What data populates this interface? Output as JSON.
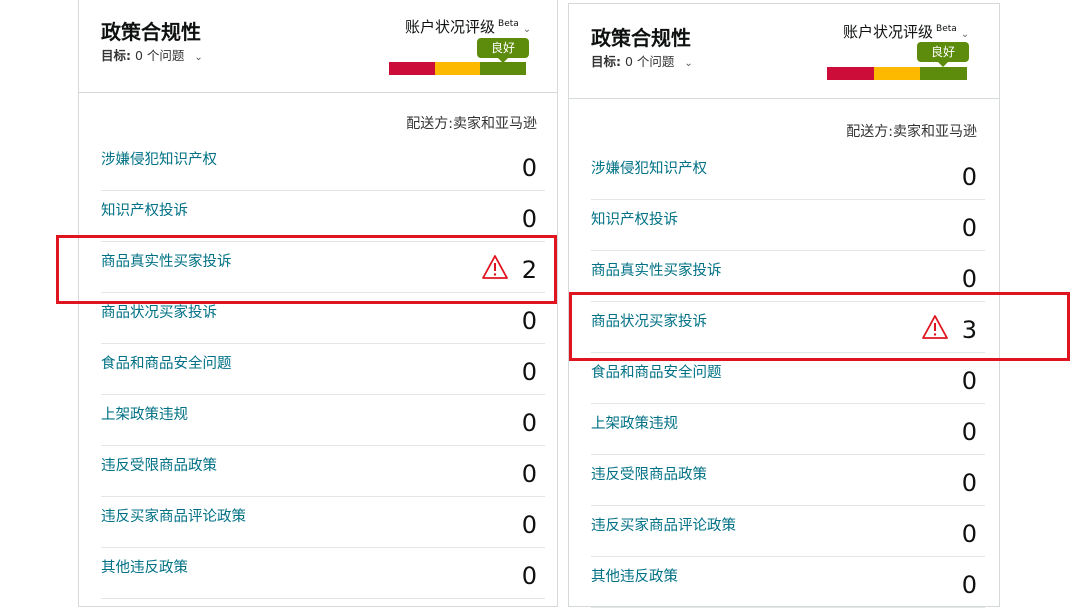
{
  "left": {
    "title": "政策合规性",
    "goal_label": "目标:",
    "goal_value": "0 个问题",
    "rating_label": "账户状况评级",
    "beta": "Beta",
    "badge": "良好",
    "ship_label": "配送方:卖家和亚马逊",
    "rows": [
      {
        "label": "涉嫌侵犯知识产权",
        "count": "0"
      },
      {
        "label": "知识产权投诉",
        "count": "0"
      },
      {
        "label": "商品真实性买家投诉",
        "count": "2",
        "warning": true
      },
      {
        "label": "商品状况买家投诉",
        "count": "0"
      },
      {
        "label": "食品和商品安全问题",
        "count": "0"
      },
      {
        "label": "上架政策违规",
        "count": "0"
      },
      {
        "label": "违反受限商品政策",
        "count": "0"
      },
      {
        "label": "违反买家商品评论政策",
        "count": "0"
      },
      {
        "label": "其他违反政策",
        "count": "0"
      }
    ]
  },
  "right": {
    "title": "政策合规性",
    "goal_label": "目标:",
    "goal_value": "0 个问题",
    "rating_label": "账户状况评级",
    "beta": "Beta",
    "badge": "良好",
    "ship_label": "配送方:卖家和亚马逊",
    "rows": [
      {
        "label": "涉嫌侵犯知识产权",
        "count": "0"
      },
      {
        "label": "知识产权投诉",
        "count": "0"
      },
      {
        "label": "商品真实性买家投诉",
        "count": "0"
      },
      {
        "label": "商品状况买家投诉",
        "count": "3",
        "warning": true
      },
      {
        "label": "食品和商品安全问题",
        "count": "0"
      },
      {
        "label": "上架政策违规",
        "count": "0"
      },
      {
        "label": "违反受限商品政策",
        "count": "0"
      },
      {
        "label": "违反买家商品评论政策",
        "count": "0"
      },
      {
        "label": "其他违反政策",
        "count": "0"
      }
    ]
  },
  "colors": {
    "link": "#007185",
    "rating_red": "#cc0c39",
    "rating_yellow": "#fcb900",
    "rating_green": "#5d8b0c",
    "highlight": "#e0141e"
  },
  "icons": {
    "warning": "warning-triangle-icon",
    "caret": "chevron-down-icon"
  }
}
